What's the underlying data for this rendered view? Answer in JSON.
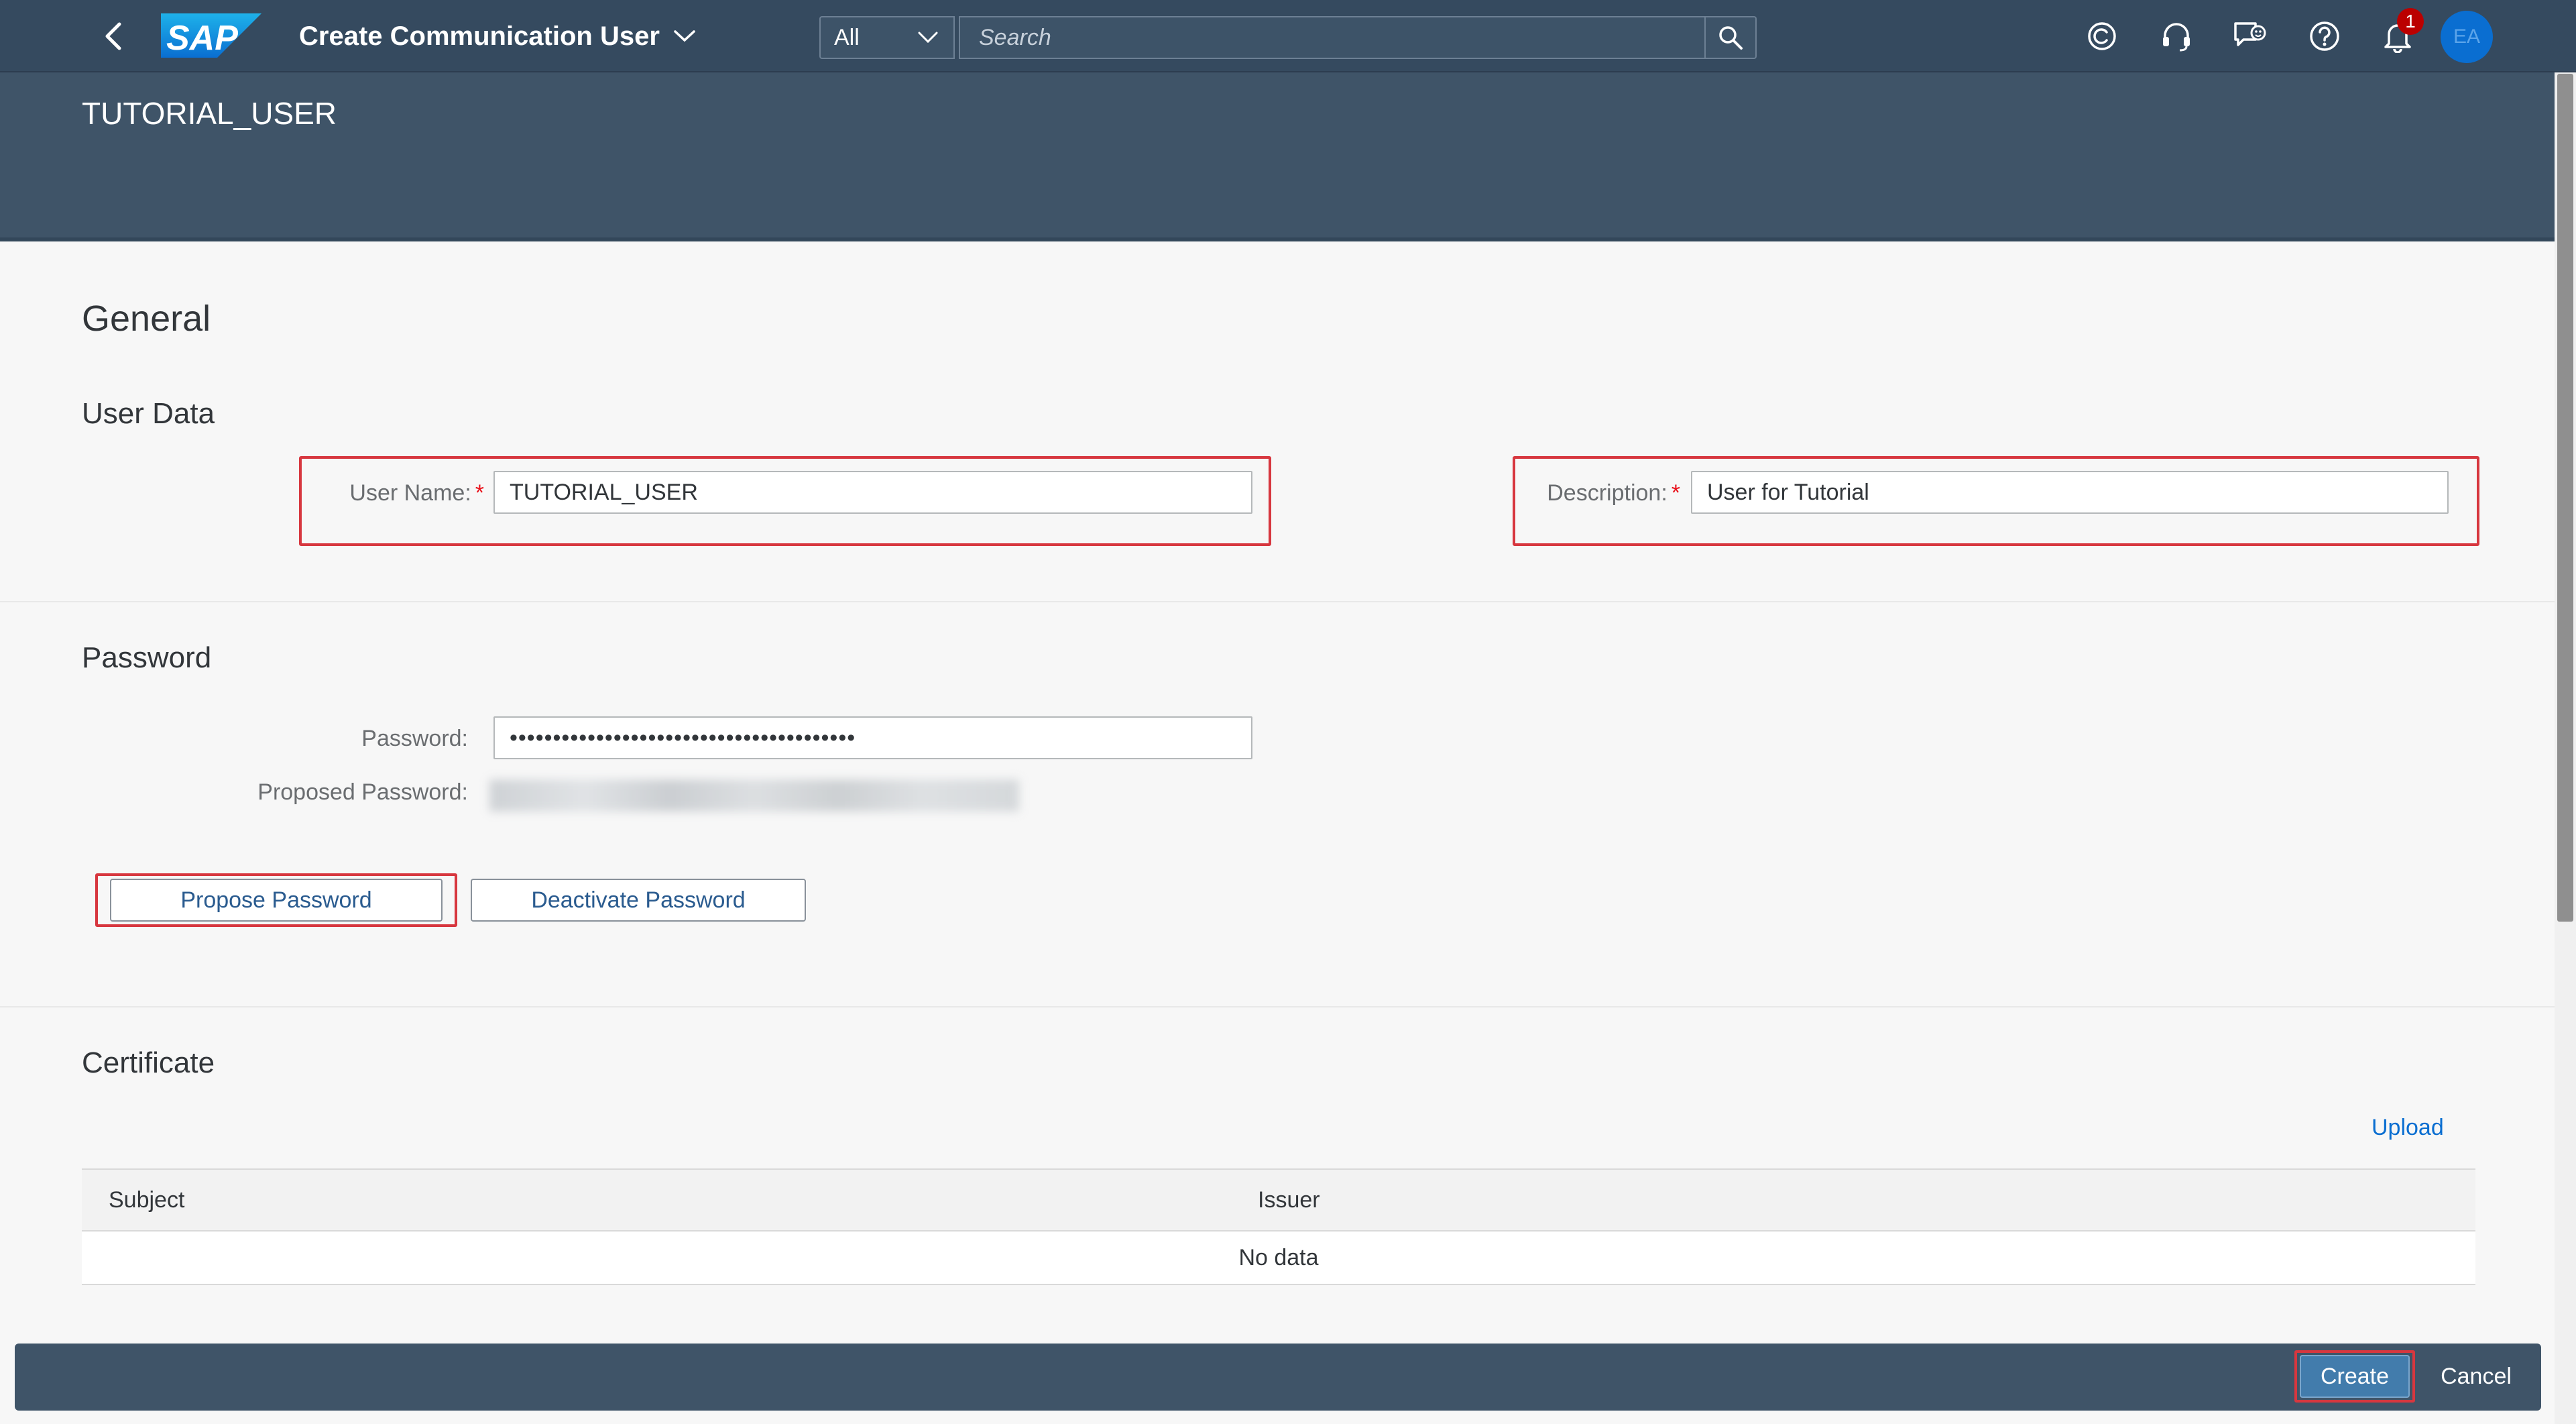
{
  "shell": {
    "logo_text": "SAP",
    "app_title": "Create Communication User",
    "search_scope": "All",
    "search_placeholder": "Search",
    "notification_count": "1",
    "avatar_initials": "EA"
  },
  "header": {
    "object_title": "TUTORIAL_USER"
  },
  "general": {
    "section_title": "General",
    "user_data_title": "User Data",
    "user_name_label": "User Name:",
    "user_name_value": "TUTORIAL_USER",
    "description_label": "Description:",
    "description_value": "User for Tutorial",
    "required_mark": "*"
  },
  "password": {
    "section_title": "Password",
    "password_label": "Password:",
    "password_value": "••••••••••••••••••••••••••••••••••••••••",
    "proposed_password_label": "Proposed Password:",
    "propose_button": "Propose Password",
    "deactivate_button": "Deactivate Password"
  },
  "certificate": {
    "section_title": "Certificate",
    "upload_link": "Upload",
    "columns": [
      "Subject",
      "Issuer"
    ],
    "empty_text": "No data"
  },
  "footer": {
    "create_button": "Create",
    "cancel_button": "Cancel"
  },
  "colors": {
    "shell_bg": "#354a5f",
    "header_bg": "#3f5468",
    "accent": "#0a6ed1",
    "highlight": "#d7373f",
    "required": "#e9101a"
  }
}
